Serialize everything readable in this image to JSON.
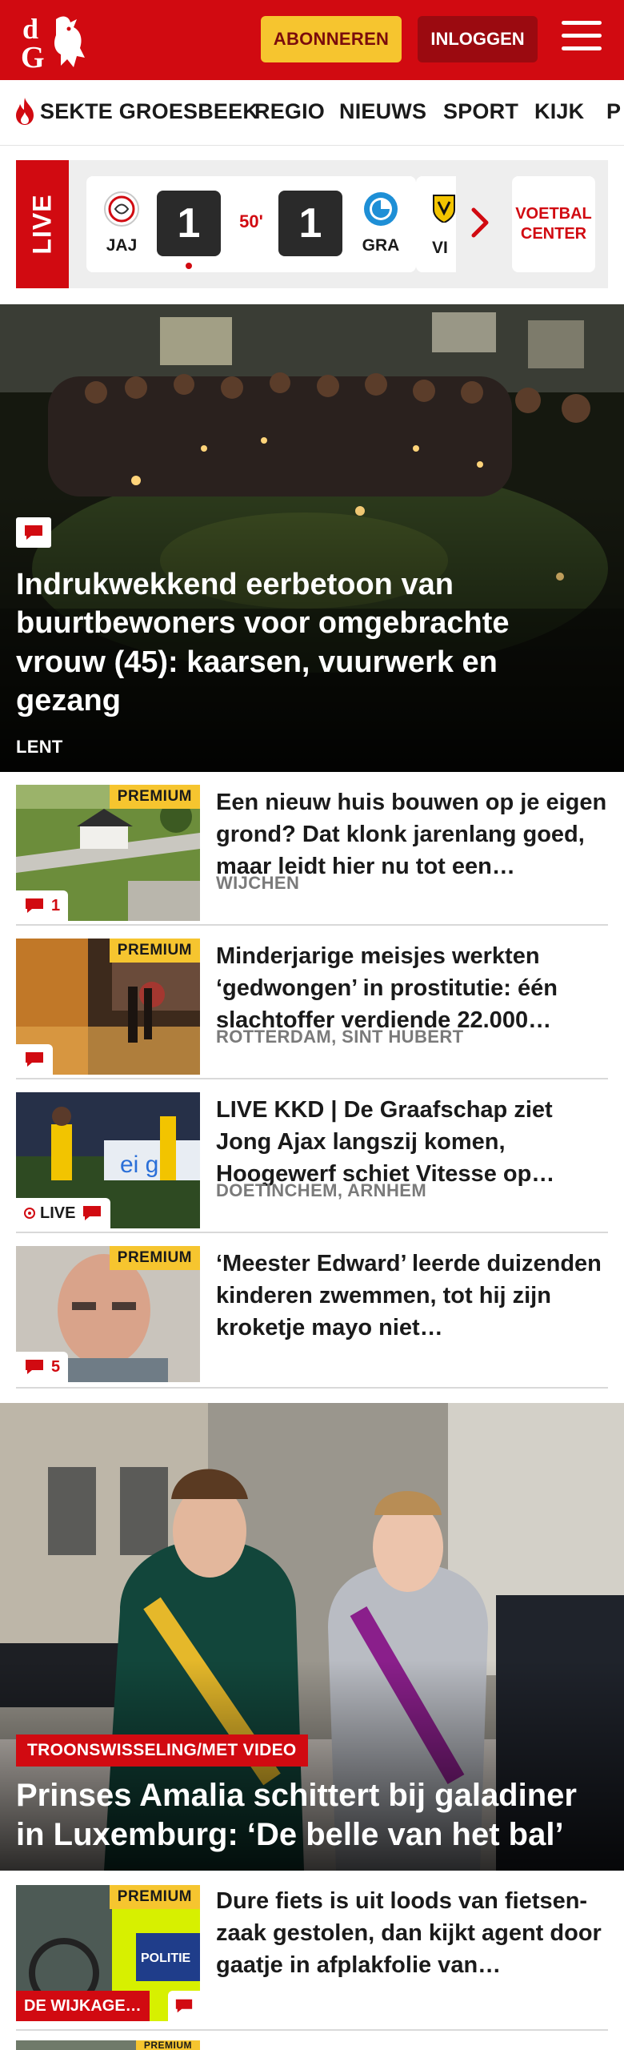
{
  "header": {
    "subscribe_label": "ABONNEREN",
    "login_label": "INLOGGEN",
    "logo_text": "dG",
    "colors": {
      "brand": "#d10a11",
      "subscribe_bg": "#f6c52f",
      "login_bg": "#9b0a10"
    }
  },
  "nav": {
    "items": [
      "SEKTE GROESBEEK",
      "REGIO",
      "NIEUWS",
      "SPORT",
      "KIJK",
      "P"
    ]
  },
  "live": {
    "tab_label": "LIVE",
    "match": {
      "home": "JAJ",
      "away": "GRA",
      "home_score": "1",
      "away_score": "1",
      "minute": "50'"
    },
    "next_match_home": "VI",
    "center_label_1": "VOETBAL",
    "center_label_2": "CENTER"
  },
  "hero": {
    "title": "Indrukwekkend eerbetoon van buurtbewoners voor omgebrachte vrouw (45): kaarsen, vuurwerk en gezang",
    "place": "LENT"
  },
  "articles": [
    {
      "premium": "PREMIUM",
      "title": "Een nieuw huis bouwen op je eigen grond? Dat klonk jarenlang goed, maar leidt hier nu tot een…",
      "place": "WIJCHEN",
      "comments": "1"
    },
    {
      "premium": "PREMIUM",
      "title": "Minderjarige meisjes werkten ‘gedwongen’ in prostitutie: één slachtoffer verdiende 22.000…",
      "place": "ROTTERDAM, SINT HUBERT",
      "comments": ""
    },
    {
      "premium": "",
      "title": "LIVE KKD | De Graafschap ziet Jong Ajax langszij komen, Hoogewerf schiet Vitesse op…",
      "place": "DOETINCHEM, ARNHEM",
      "comments": "",
      "live_label": "LIVE"
    },
    {
      "premium": "PREMIUM",
      "title": "‘Meester Edward’ leerde duizenden kinderen zwemmen, tot hij zijn kroketje mayo niet…",
      "place": "",
      "comments": "5"
    }
  ],
  "feature": {
    "tag": "TROONSWISSELING/MET VIDEO",
    "title": "Prinses Amalia schittert bij galadiner in Luxemburg: ‘De belle van het bal’"
  },
  "bottom_article": {
    "premium": "PREMIUM",
    "tag": "DE WIJKAGE…",
    "title": "Dure fiets is uit loods van fietsen-zaak gestolen, dan kijkt agent door gaatje in afplakfolie van…"
  },
  "peek_article": {
    "premium": "PREMIUM"
  }
}
